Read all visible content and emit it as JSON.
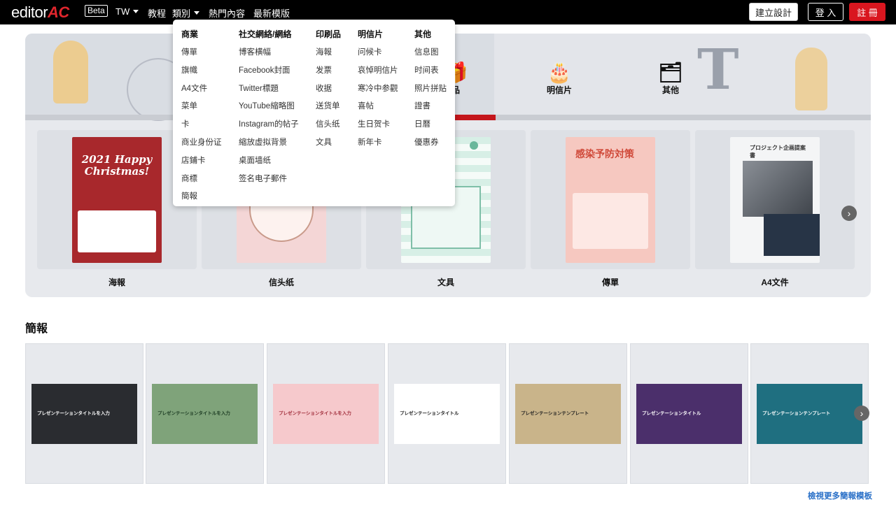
{
  "brand": {
    "name_prefix": "editor",
    "name_suffix": "AC",
    "badge": "Beta"
  },
  "nav": {
    "lang": "TW",
    "tutorial": "教程",
    "category": "類別",
    "popular": "熱門內容",
    "latest": "最新模版"
  },
  "actions": {
    "create": "建立設計",
    "login": "登 入",
    "register": "註 冊"
  },
  "dropdown": {
    "columns": [
      {
        "head": "商業",
        "items": [
          "傳單",
          "旗幟",
          "A4文件",
          "菜单",
          "卡",
          "商业身份证",
          "店鋪卡",
          "商標",
          "簡報"
        ]
      },
      {
        "head": "社交網絡/網絡",
        "items": [
          "博客横幅",
          "Facebook封面",
          "Twitter標題",
          "YouTube縮略图",
          "Instagram的帖子",
          "縮放虚拟背景",
          "桌面墙纸",
          "签名电子郵件"
        ]
      },
      {
        "head": "印刷品",
        "items": [
          "海報",
          "发票",
          "收据",
          "送货单",
          "信头纸",
          "文具"
        ]
      },
      {
        "head": "明信片",
        "items": [
          "问候卡",
          "哀悼明信片",
          "寒冷中参觀",
          "喜帖",
          "生日贺卡",
          "新年卡"
        ]
      },
      {
        "head": "其他",
        "items": [
          "信息图",
          "时间表",
          "照片拼贴",
          "證書",
          "日曆",
          "優惠券"
        ]
      }
    ]
  },
  "hero": {
    "tabs": [
      {
        "label": "品",
        "icon": "gift-icon"
      },
      {
        "label": "明信片",
        "icon": "cake-icon"
      },
      {
        "label": "其他",
        "icon": "folder-icon"
      }
    ],
    "cards": [
      {
        "label": "海報",
        "thumb_text": "2021 Happy Christmas!"
      },
      {
        "label": "信头纸",
        "thumb_text": ""
      },
      {
        "label": "文具",
        "thumb_text": ""
      },
      {
        "label": "傳單",
        "thumb_text": "感染予防対策"
      },
      {
        "label": "A4文件",
        "thumb_text": "プロジェクト企画提案書"
      }
    ]
  },
  "presentations": {
    "title": "簡報",
    "more_link": "檢視更多簡報模板",
    "items": [
      {
        "text": "プレゼンテーションタイトルを入力",
        "bg": "#2a2c30",
        "fg": "#ffffff"
      },
      {
        "text": "プレゼンテーションタイトルを入力",
        "bg": "#7fa37a",
        "fg": "#1b3a22"
      },
      {
        "text": "プレゼンテーションタイトルを入力",
        "bg": "#f6c9cc",
        "fg": "#a02c3a"
      },
      {
        "text": "プレゼンテーションタイトル",
        "bg": "#ffffff",
        "fg": "#222222"
      },
      {
        "text": "プレゼンテーションテンプレート",
        "bg": "#c9b48a",
        "fg": "#222222"
      },
      {
        "text": "プレゼンテーションタイトル",
        "bg": "#4b2f6b",
        "fg": "#ffffff"
      },
      {
        "text": "プレゼンテーションテンプレート",
        "bg": "#1f6f80",
        "fg": "#ffffff"
      }
    ]
  }
}
